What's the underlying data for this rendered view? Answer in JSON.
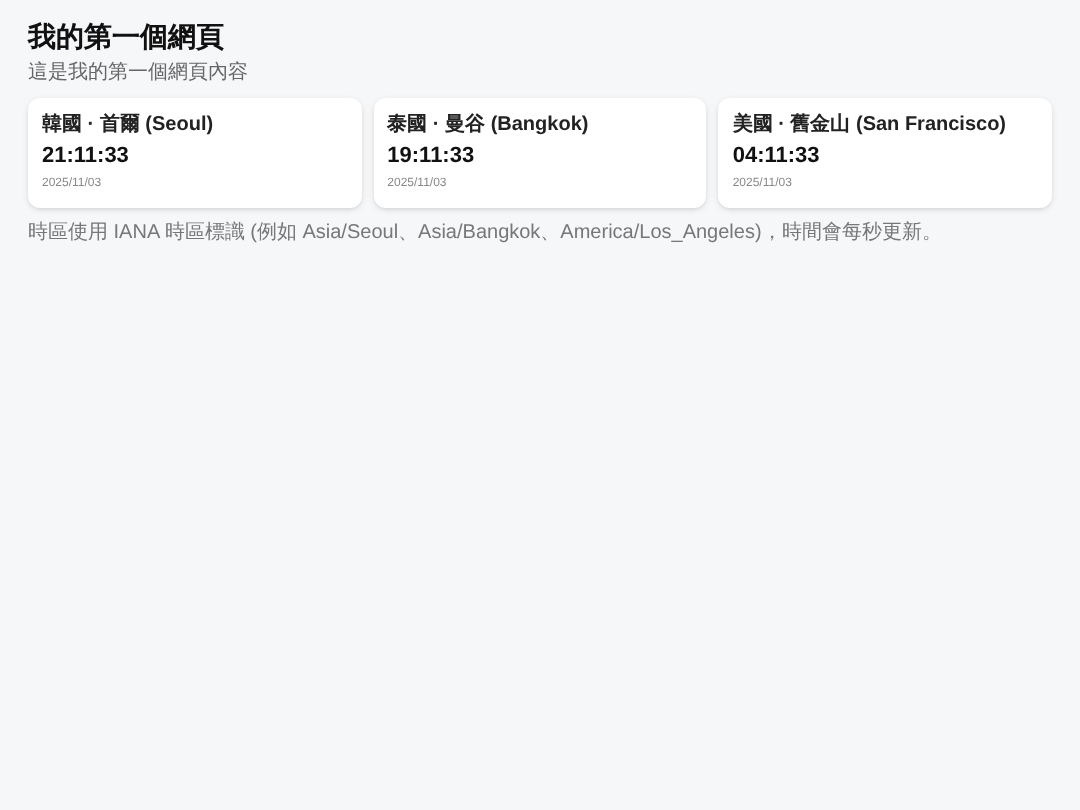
{
  "page": {
    "title": "我的第一個網頁",
    "subtitle": "這是我的第一個網頁內容"
  },
  "clocks": [
    {
      "place": "韓國 · 首爾 (Seoul)",
      "time": "21:11:33",
      "date": "2025/11/03"
    },
    {
      "place": "泰國 · 曼谷 (Bangkok)",
      "time": "19:11:33",
      "date": "2025/11/03"
    },
    {
      "place": "美國 · 舊金山 (San Francisco)",
      "time": "04:11:33",
      "date": "2025/11/03"
    }
  ],
  "note": "時區使用 IANA 時區標識 (例如 Asia/Seoul、Asia/Bangkok、America/Los_Angeles)，時間會每秒更新。"
}
